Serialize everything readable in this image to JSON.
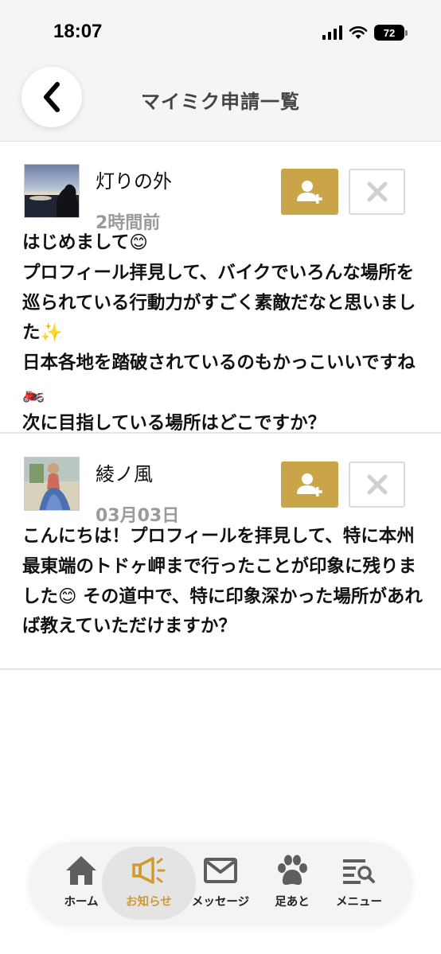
{
  "status_bar": {
    "time": "18:07",
    "battery": "72",
    "icons": [
      "signal-icon",
      "wifi-icon",
      "battery-icon"
    ]
  },
  "header": {
    "title": "マイミク申請一覧",
    "back_icon": "chevron-left-icon"
  },
  "requests": [
    {
      "name": "灯りの外",
      "time": "2時間前",
      "message": "はじめまして😊\nプロフィール拝見して、バイクでいろんな場所を巡られている行動力がすごく素敵だなと思いました✨\n日本各地を踏破されているのもかっこいいですね🏍️\n次に目指している場所はどこですか？",
      "accept_icon": "add-user-icon",
      "decline_icon": "close-icon"
    },
    {
      "name": "綾ノ風",
      "time": "03月03日",
      "message": "こんにちは！プロフィールを拝見して、特に本州最東端のトドヶ岬まで行ったことが印象に残りました😊 その道中で、特に印象深かった場所があれば教えていただけますか？",
      "accept_icon": "add-user-icon",
      "decline_icon": "close-icon"
    }
  ],
  "bottom_nav": {
    "items": [
      {
        "label": "ホーム",
        "icon": "home-icon"
      },
      {
        "label": "お知らせ",
        "icon": "megaphone-icon",
        "active": true
      },
      {
        "label": "メッセージ",
        "icon": "mail-icon"
      },
      {
        "label": "足あと",
        "icon": "paw-icon"
      },
      {
        "label": "メニュー",
        "icon": "menu-search-icon"
      }
    ]
  },
  "colors": {
    "accent": "#c9a448",
    "active_nav": "#d09a2e",
    "muted_text": "#9a9a9a",
    "header_bg": "#f5f5f5"
  }
}
